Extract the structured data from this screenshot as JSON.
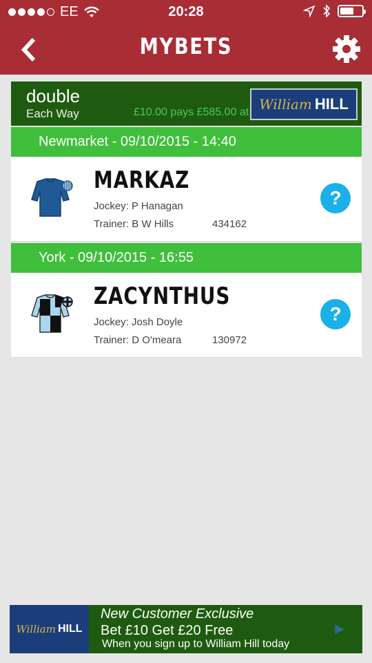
{
  "status_bar": {
    "carrier": "EE",
    "time": "20:28"
  },
  "nav": {
    "title": "MYBETS"
  },
  "bet": {
    "type": "double",
    "each_way": "Each Way",
    "pays": "£10.00 pays £585.00 at",
    "bookmaker_script": "William",
    "bookmaker_bold": "HILL"
  },
  "races": [
    {
      "header": "Newmarket - 09/10/2015 - 14:40",
      "horse": "MARKAZ",
      "jockey": "Jockey: P Hanagan",
      "trainer": "Trainer: B W Hills",
      "id": "434162"
    },
    {
      "header": "York - 09/10/2015 - 16:55",
      "horse": "ZACYNTHUS",
      "jockey": "Jockey: Josh Doyle",
      "trainer": "Trainer: D O'meara",
      "id": "130972"
    }
  ],
  "help_label": "?",
  "ad": {
    "logo_script": "William",
    "logo_bold": "HILL",
    "line1": "New Customer Exclusive",
    "line2": "Bet £10 Get £20 Free",
    "line3": "When you sign up to William Hill today"
  },
  "colors": {
    "nav_bg": "#a82d35",
    "bet_header_bg": "#1e5b10",
    "race_bar_bg": "#3fbf3c",
    "help_bg": "#1ab0e8",
    "wh_blue": "#1b3e7a"
  }
}
